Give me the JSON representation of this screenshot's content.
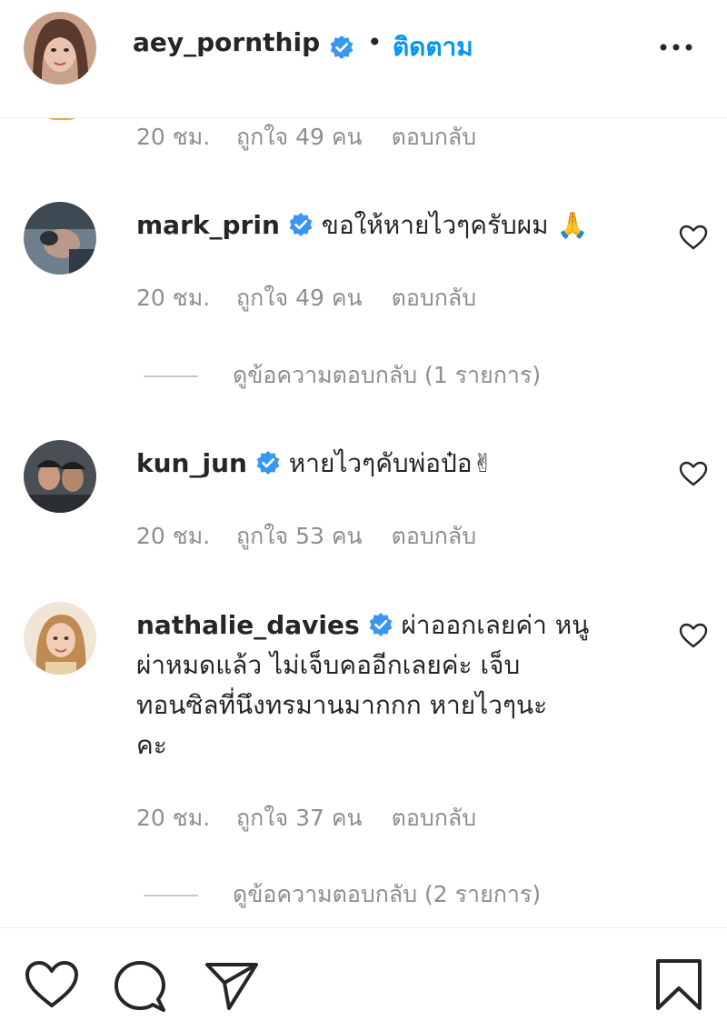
{
  "post_header": {
    "username": "aey_pornthip",
    "separator": "•",
    "follow_label": "ติดตาม"
  },
  "previous_meta": {
    "time": "20 ชม.",
    "likes": "ถูกใจ 49 คน",
    "reply": "ตอบกลับ"
  },
  "comments": [
    {
      "username": "mark_prin",
      "text": "ขอให้หายไวๆครับผม 🙏",
      "time": "20 ชม.",
      "likes": "ถูกใจ 49 คน",
      "reply": "ตอบกลับ",
      "view_replies": "ดูข้อความตอบกลับ (1 รายการ)"
    },
    {
      "username": "kun_jun",
      "text": "หายไวๆคับพ่อป๋อ✌",
      "time": "20 ชม.",
      "likes": "ถูกใจ 53 คน",
      "reply": "ตอบกลับ"
    },
    {
      "username": "nathalie_davies",
      "text": "ผ่าออกเลยค่า หนูผ่าหมดแล้ว ไม่เจ็บคออีกเลยค่ะ เจ็บทอนซิลที่นึงทรมานมากกก หายไวๆนะคะ",
      "line1": "ผ่าออกเลยค่า หนู",
      "line2": "ผ่าหมดแล้ว ไม่เจ็บคออีกเลยค่ะ เจ็บ",
      "line3": "ทอนซิลที่นึงทรมานมากกก หายไวๆนะ",
      "line4": "คะ",
      "time": "20 ชม.",
      "likes": "ถูกใจ 37 คน",
      "reply": "ตอบกลับ",
      "view_replies": "ดูข้อความตอบกลับ (2 รายการ)"
    }
  ],
  "icons": {
    "verified": "verified-badge-icon",
    "more": "more-options-icon",
    "like": "heart-icon",
    "comment": "comment-bubble-icon",
    "share": "paper-plane-icon",
    "save": "bookmark-icon"
  },
  "colors": {
    "accent": "#0095f6",
    "muted": "#8e8e8e",
    "text": "#262626"
  }
}
